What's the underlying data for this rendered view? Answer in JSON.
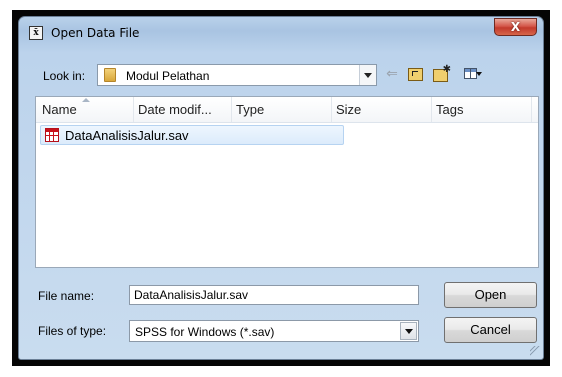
{
  "window": {
    "title": "Open Data File",
    "close_label": "X"
  },
  "toolbar": {
    "look_in_label": "Look in:",
    "look_in_value": "Modul Pelathan"
  },
  "file_list": {
    "columns": [
      "Name",
      "Date modif...",
      "Type",
      "Size",
      "Tags"
    ],
    "files": [
      {
        "name": "DataAnalisisJalur.sav",
        "icon": "spss-data-icon",
        "selected": true
      }
    ]
  },
  "footer": {
    "file_name_label": "File name:",
    "file_name_value": "DataAnalisisJalur.sav",
    "file_type_label": "Files of type:",
    "file_type_value": "SPSS for Windows (*.sav)",
    "open_label": "Open",
    "cancel_label": "Cancel"
  },
  "colors": {
    "title_bar": "#b9d1ea",
    "selection": "#dcebfb",
    "close_button": "#c23a2c"
  }
}
